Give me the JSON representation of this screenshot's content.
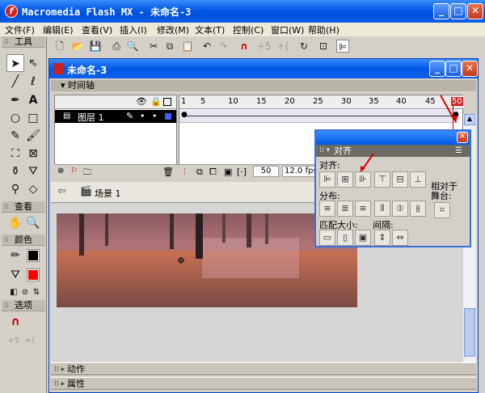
{
  "window": {
    "title": "Macromedia Flash MX - 未命名-3",
    "app_icon": "flash-icon"
  },
  "menu": [
    "文件(F)",
    "编辑(E)",
    "查看(V)",
    "插入(I)",
    "修改(M)",
    "文本(T)",
    "控制(C)",
    "窗口(W)",
    "帮助(H)"
  ],
  "tools": {
    "header": "工具",
    "view_header": "查看",
    "colors_header": "颜色",
    "options_header": "选项",
    "items": [
      "arrow",
      "subselect",
      "line",
      "lasso",
      "pen",
      "text",
      "oval",
      "rectangle",
      "pencil",
      "brush",
      "free-transform",
      "fill-transform",
      "ink-bottle",
      "paint-bucket",
      "eyedropper",
      "eraser",
      "hand",
      "zoom"
    ]
  },
  "document": {
    "title": "未命名-3",
    "timeline_label": "时间轴",
    "layer_name": "图层 1",
    "ruler_ticks": [
      "1",
      "5",
      "10",
      "15",
      "20",
      "25",
      "30",
      "35",
      "40",
      "45",
      "50"
    ],
    "current_frame": "50",
    "fps": "12.0 fps",
    "scene_label": "场景 1"
  },
  "panels": {
    "actions": "动作",
    "properties": "属性"
  },
  "align_panel": {
    "title": "对齐",
    "align_label": "对齐:",
    "distribute_label": "分布:",
    "match_size_label": "匹配大小:",
    "spacing_label": "间隔:",
    "relative_label_1": "相对于",
    "relative_label_2": "舞台:"
  },
  "colors": {
    "titlebar": "#0058e6",
    "stroke": "#000000",
    "fill": "#ff0000",
    "playhead": "#cc0000"
  }
}
